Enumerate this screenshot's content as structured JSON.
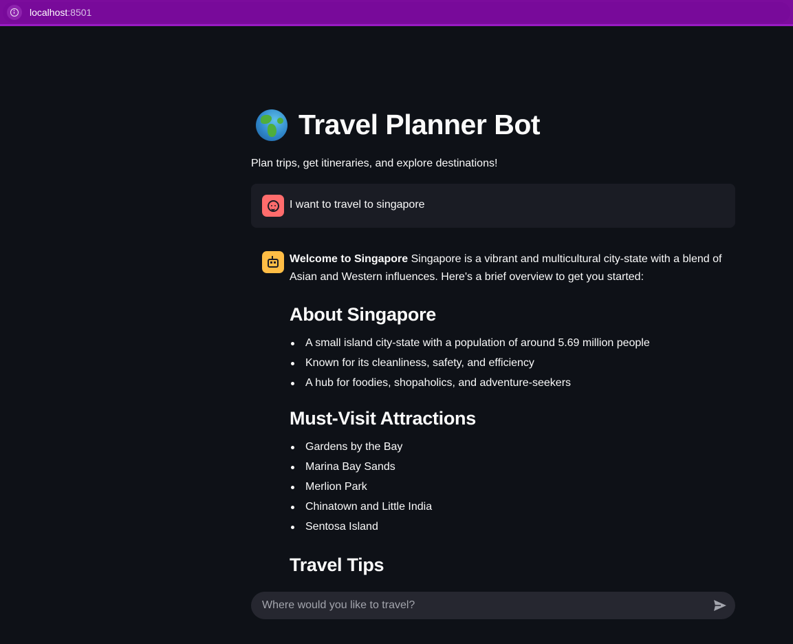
{
  "browser": {
    "host": "localhost",
    "port": ":8501"
  },
  "header": {
    "icon": "globe-icon",
    "title": "Travel Planner Bot",
    "subtitle": "Plan trips, get itineraries, and explore destinations!"
  },
  "messages": {
    "user": {
      "avatar": "user-face-icon",
      "text": "I want to travel to singapore"
    },
    "assistant": {
      "avatar": "robot-icon",
      "intro_bold": "Welcome to Singapore",
      "intro_text": " Singapore is a vibrant and multicultural city-state with a blend of Asian and Western influences. Here's a brief overview to get you started:",
      "sections": [
        {
          "heading": "About Singapore",
          "items": [
            "A small island city-state with a population of around 5.69 million people",
            "Known for its cleanliness, safety, and efficiency",
            "A hub for foodies, shopaholics, and adventure-seekers"
          ]
        },
        {
          "heading": "Must-Visit Attractions",
          "items": [
            "Gardens by the Bay",
            "Marina Bay Sands",
            "Merlion Park",
            "Chinatown and Little India",
            "Sentosa Island"
          ]
        },
        {
          "heading": "Travel Tips",
          "items": []
        }
      ]
    }
  },
  "chat_input": {
    "placeholder": "Where would you like to travel?",
    "send_icon": "send-icon"
  },
  "colors": {
    "browser_bar": "#7b0c9c",
    "background": "#0e1117",
    "user_message_bg": "#1a1c24",
    "user_avatar": "#ff6c6c",
    "bot_avatar": "#ffbd45",
    "input_bg": "#262730"
  }
}
